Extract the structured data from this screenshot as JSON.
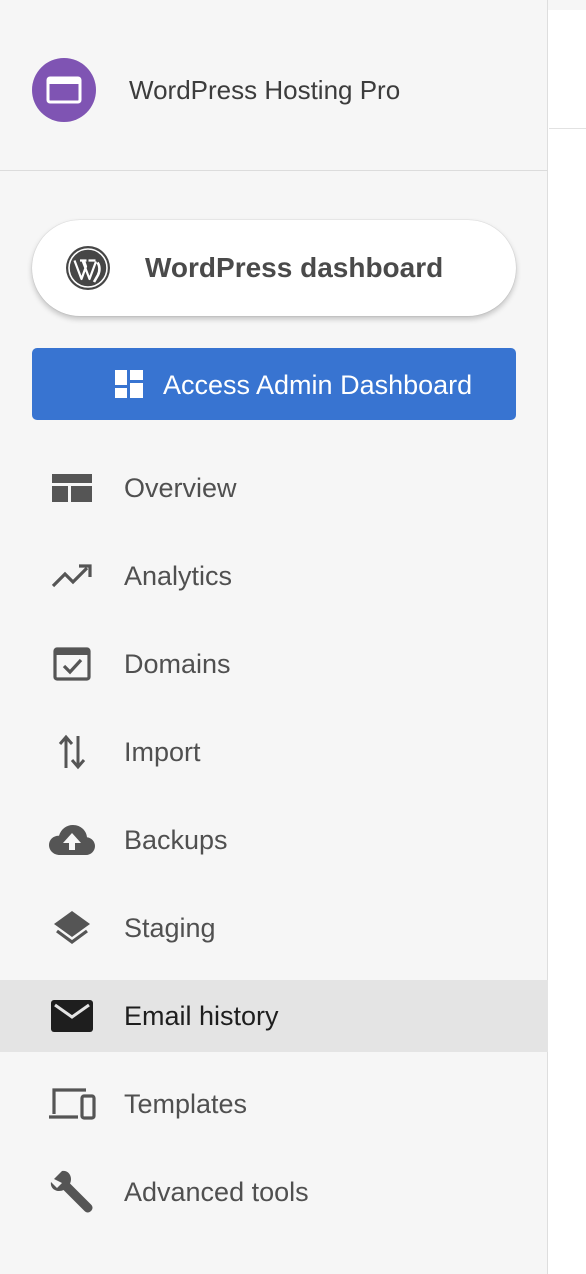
{
  "site": {
    "name": "WordPress Hosting Pro",
    "avatar_color": "#7f54b3",
    "avatar_icon": "browser-window-icon"
  },
  "wordpress_button": {
    "label": "WordPress dashboard",
    "icon": "wordpress-logo-icon"
  },
  "admin_button": {
    "label": "Access Admin Dashboard",
    "icon": "dashboard-grid-icon",
    "color": "#3874d1"
  },
  "nav": {
    "items": [
      {
        "label": "Overview",
        "icon": "overview-layout-icon",
        "active": false
      },
      {
        "label": "Analytics",
        "icon": "trending-up-icon",
        "active": false
      },
      {
        "label": "Domains",
        "icon": "domain-check-icon",
        "active": false
      },
      {
        "label": "Import",
        "icon": "import-arrows-icon",
        "active": false
      },
      {
        "label": "Backups",
        "icon": "cloud-upload-icon",
        "active": false
      },
      {
        "label": "Staging",
        "icon": "layers-icon",
        "active": false
      },
      {
        "label": "Email history",
        "icon": "mail-icon",
        "active": true
      },
      {
        "label": "Templates",
        "icon": "devices-icon",
        "active": false
      },
      {
        "label": "Advanced tools",
        "icon": "wrench-icon",
        "active": false
      }
    ]
  }
}
